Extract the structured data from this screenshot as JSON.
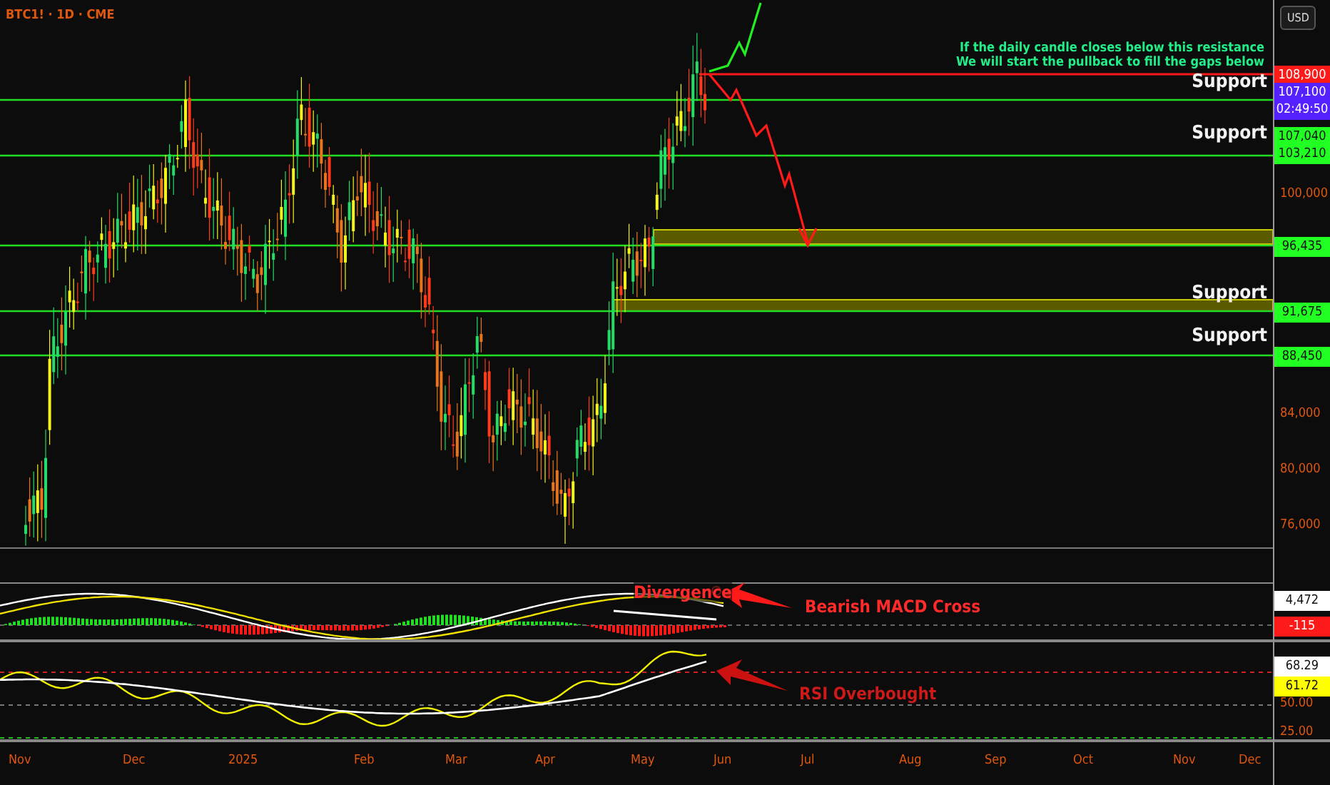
{
  "symbol": "BTC1! · 1D · CME",
  "currency": "USD",
  "note": [
    "If the daily candle closes below this resistance",
    "We will start the pullback to fill the gaps below"
  ],
  "support_labels": [
    "Support",
    "Support",
    "Support",
    "Support"
  ],
  "price_ticks": [
    "100,000",
    "84,000",
    "80,000",
    "76,000"
  ],
  "price_badges": [
    {
      "lines": [
        "108,900"
      ],
      "color": "#ff1a1a"
    },
    {
      "lines": [
        "107,100",
        "02:49:50"
      ],
      "color": "#5522ff"
    },
    {
      "lines": [
        "107,040",
        "103,210"
      ],
      "color": "#22ff22"
    },
    {
      "lines": [
        "96,435"
      ],
      "color": "#22ff22"
    },
    {
      "lines": [
        "91,675"
      ],
      "color": "#22ff22"
    },
    {
      "lines": [
        "88,450"
      ],
      "color": "#22ff22"
    }
  ],
  "macd": {
    "divergence_label": "Divergence",
    "callout": "Bearish MACD Cross",
    "badges": [
      {
        "text": "4,472",
        "color": "#ffffff"
      },
      {
        "text": "-115",
        "color": "#ff1a1a"
      }
    ]
  },
  "rsi": {
    "callout": "RSI Overbought",
    "ticks": [
      "50.00",
      "25.00"
    ],
    "badges": [
      {
        "text": "68.29",
        "color": "#ffffff"
      },
      {
        "text": "61.72",
        "color": "#ffff00"
      }
    ]
  },
  "time_axis": [
    "Nov",
    "Dec",
    "2025",
    "Feb",
    "Mar",
    "Apr",
    "May",
    "Jun",
    "Jul",
    "Aug",
    "Sep",
    "Oct",
    "Nov",
    "Dec"
  ]
}
